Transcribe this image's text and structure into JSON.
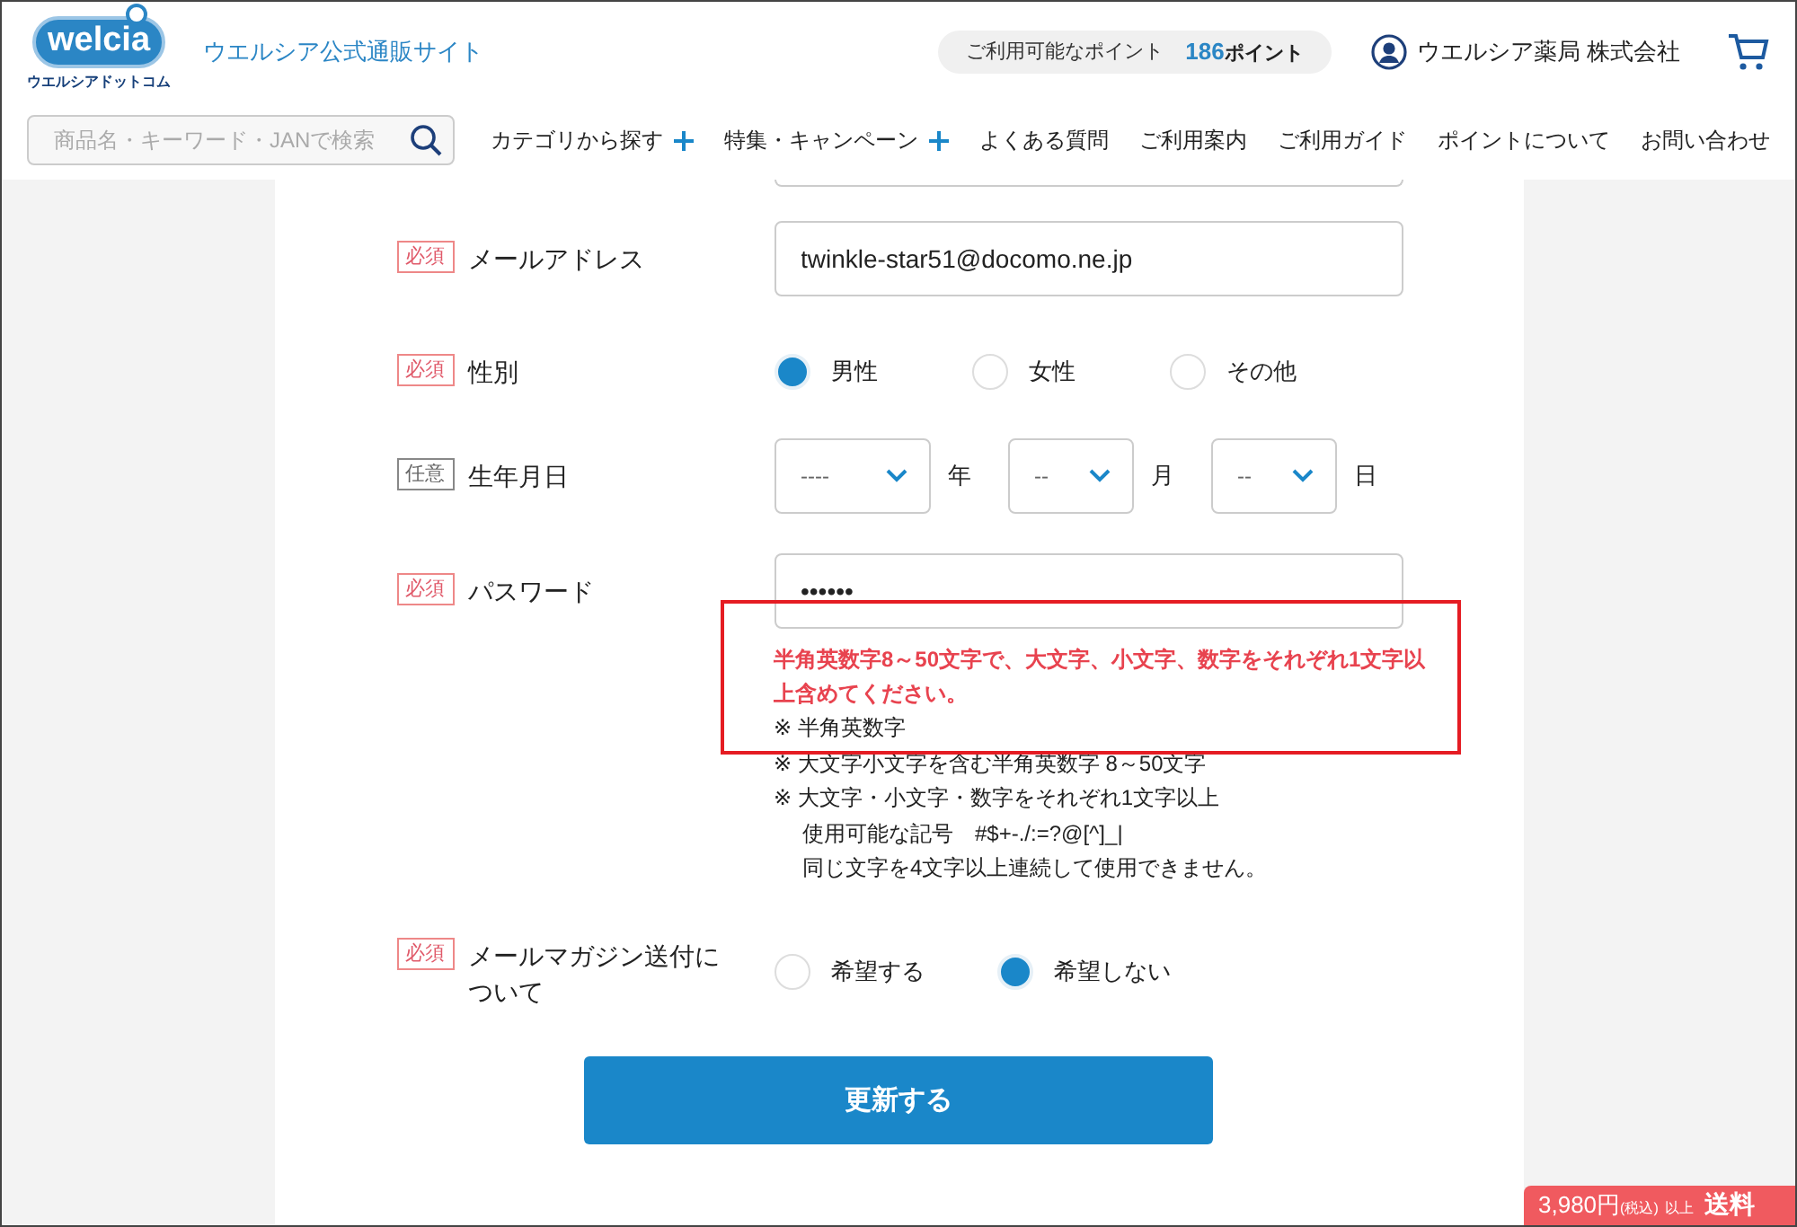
{
  "header": {
    "logo": {
      "brand": "welcia",
      "tagline": "ウエルシアドットコム"
    },
    "site_title": "ウエルシア公式通販サイト",
    "points": {
      "label": "ご利用可能なポイント",
      "value": "186",
      "unit": "ポイント"
    },
    "user_name": "ウエルシア薬局 株式会社",
    "search": {
      "placeholder": "商品名・キーワード・JANで検索"
    },
    "nav": [
      {
        "label": "カテゴリから探す",
        "expandable": true
      },
      {
        "label": "特集・キャンペーン",
        "expandable": true
      },
      {
        "label": "よくある質問",
        "expandable": false
      },
      {
        "label": "ご利用案内",
        "expandable": false
      },
      {
        "label": "ご利用ガイド",
        "expandable": false
      },
      {
        "label": "ポイントについて",
        "expandable": false
      },
      {
        "label": "お問い合わせ",
        "expandable": false
      }
    ]
  },
  "form": {
    "rows": [
      {
        "kind": "text",
        "badge": "必須",
        "required": true,
        "label": "メールアドレス",
        "value": "twinkle-star51@docomo.ne.jp"
      },
      {
        "kind": "radio",
        "badge": "必須",
        "required": true,
        "label": "性別",
        "options": [
          {
            "label": "男性",
            "selected": true
          },
          {
            "label": "女性",
            "selected": false
          },
          {
            "label": "その他",
            "selected": false
          }
        ]
      },
      {
        "kind": "date",
        "badge": "任意",
        "required": false,
        "label": "生年月日",
        "selects": [
          {
            "value": "----",
            "unit": "年"
          },
          {
            "value": "--",
            "unit": "月"
          },
          {
            "value": "--",
            "unit": "日"
          }
        ]
      },
      {
        "kind": "password",
        "badge": "必須",
        "required": true,
        "label": "パスワード",
        "value": "••••••",
        "error": "半角英数字8～50文字で、大文字、小文字、数字をそれぞれ1文字以上含めてください。",
        "highlighted": true,
        "notes": [
          "※ 半角英数字",
          "※ 大文字小文字を含む半角英数字 8～50文字",
          "※ 大文字・小文字・数字をそれぞれ1文字以上",
          "使用可能な記号　#$+-./:=?@[^]_|",
          "同じ文字を4文字以上連続して使用できません。"
        ]
      },
      {
        "kind": "radio",
        "badge": "必須",
        "required": true,
        "label": "メールマガジン送付について",
        "options": [
          {
            "label": "希望する",
            "selected": false
          },
          {
            "label": "希望しない",
            "selected": true
          }
        ]
      }
    ],
    "submit": "更新する"
  },
  "banner": {
    "price": "3,980",
    "unit": "円",
    "tax": "(税込)",
    "suffix": "以上",
    "label": "送料"
  }
}
